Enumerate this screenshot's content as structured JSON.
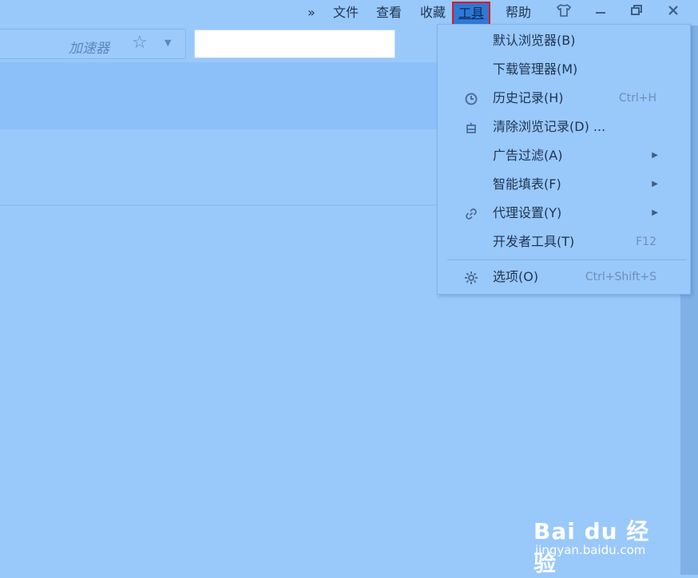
{
  "menubar": {
    "more": "»",
    "items": [
      "文件",
      "查看",
      "收藏",
      "工具",
      "帮助"
    ],
    "active_item": "工具",
    "active_highlight_color": "#e01a1a"
  },
  "window_controls": {
    "skin_icon": "shirt-icon",
    "minimize_icon": "minimize-icon",
    "restore_icon": "restore-icon",
    "close_icon": "close-icon"
  },
  "toolbar": {
    "accelerator_label": "加速器",
    "favorite_icon": "star-icon",
    "search_value": ""
  },
  "dropdown": {
    "items": [
      {
        "icon": "",
        "label": "默认浏览器(B)",
        "shortcut": "",
        "has_submenu": false
      },
      {
        "icon": "",
        "label": "下载管理器(M)",
        "shortcut": "",
        "has_submenu": false
      },
      {
        "icon": "clock-icon",
        "label": "历史记录(H)",
        "shortcut": "Ctrl+H",
        "has_submenu": false
      },
      {
        "icon": "eraser-icon",
        "label": "清除浏览记录(D) ...",
        "shortcut": "",
        "has_submenu": false
      },
      {
        "icon": "",
        "label": "广告过滤(A)",
        "shortcut": "",
        "has_submenu": true
      },
      {
        "icon": "",
        "label": "智能填表(F)",
        "shortcut": "",
        "has_submenu": true
      },
      {
        "icon": "link-icon",
        "label": "代理设置(Y)",
        "shortcut": "",
        "has_submenu": true
      },
      {
        "icon": "",
        "label": "开发者工具(T)",
        "shortcut": "F12",
        "has_submenu": false
      },
      {
        "icon": "gear-icon",
        "label": "选项(O)",
        "shortcut": "Ctrl+Shift+S",
        "has_submenu": false
      }
    ]
  },
  "watermark": {
    "main": "Bai du 经验",
    "sub": "jingyan.baidu.com"
  }
}
